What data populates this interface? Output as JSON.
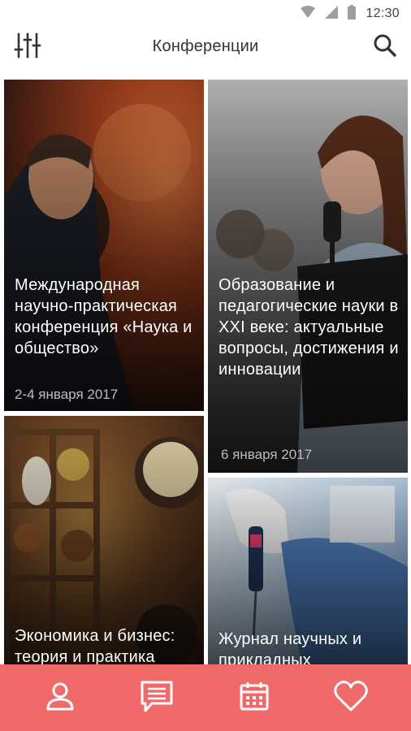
{
  "status_bar": {
    "time": "12:30",
    "icons": [
      "wifi-icon",
      "signal-icon",
      "battery-icon"
    ]
  },
  "app_bar": {
    "title": "Конференции",
    "left_icon": "filter-sliders-icon",
    "right_icon": "search-icon"
  },
  "cards": [
    {
      "title": "Международная научно-практическая конференция «Наука и общество»",
      "date": "2-4 января 2017"
    },
    {
      "title": "Образование и педагогические науки в XXI веке: актуальные вопросы, достижения и инновации",
      "date": "6 января 2017"
    },
    {
      "title": "Экономика и бизнес: теория и практика",
      "date": ""
    },
    {
      "title": "Журнал научных и прикладных",
      "date": ""
    }
  ],
  "bottom_nav": {
    "items": [
      "profile-icon",
      "messages-icon",
      "calendar-icon",
      "favorites-heart-icon"
    ]
  },
  "colors": {
    "accent": "#f16a6a",
    "date_text": "#bdbdbd",
    "title_text": "#ffffff"
  }
}
